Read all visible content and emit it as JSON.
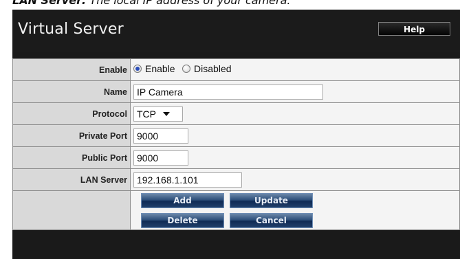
{
  "caption": {
    "bold_part": "LAN Server:",
    "rest": " The local IP address of your camera."
  },
  "header": {
    "title": "Virtual Server",
    "help_label": "Help"
  },
  "form": {
    "enable": {
      "label": "Enable",
      "options": [
        "Enable",
        "Disabled"
      ],
      "selected": "Enable"
    },
    "name": {
      "label": "Name",
      "value": "IP Camera"
    },
    "protocol": {
      "label": "Protocol",
      "value": "TCP"
    },
    "private_port": {
      "label": "Private Port",
      "value": "9000"
    },
    "public_port": {
      "label": "Public Port",
      "value": "9000"
    },
    "lan_server": {
      "label": "LAN Server",
      "value": "192.168.1.101"
    }
  },
  "buttons": {
    "add": "Add",
    "update": "Update",
    "delete": "Delete",
    "cancel": "Cancel"
  },
  "colors": {
    "header_bg": "#1b1b1b",
    "label_bg": "#d9d9d9",
    "value_bg": "#f4f4f4",
    "button_blue": "#1f3c66"
  }
}
